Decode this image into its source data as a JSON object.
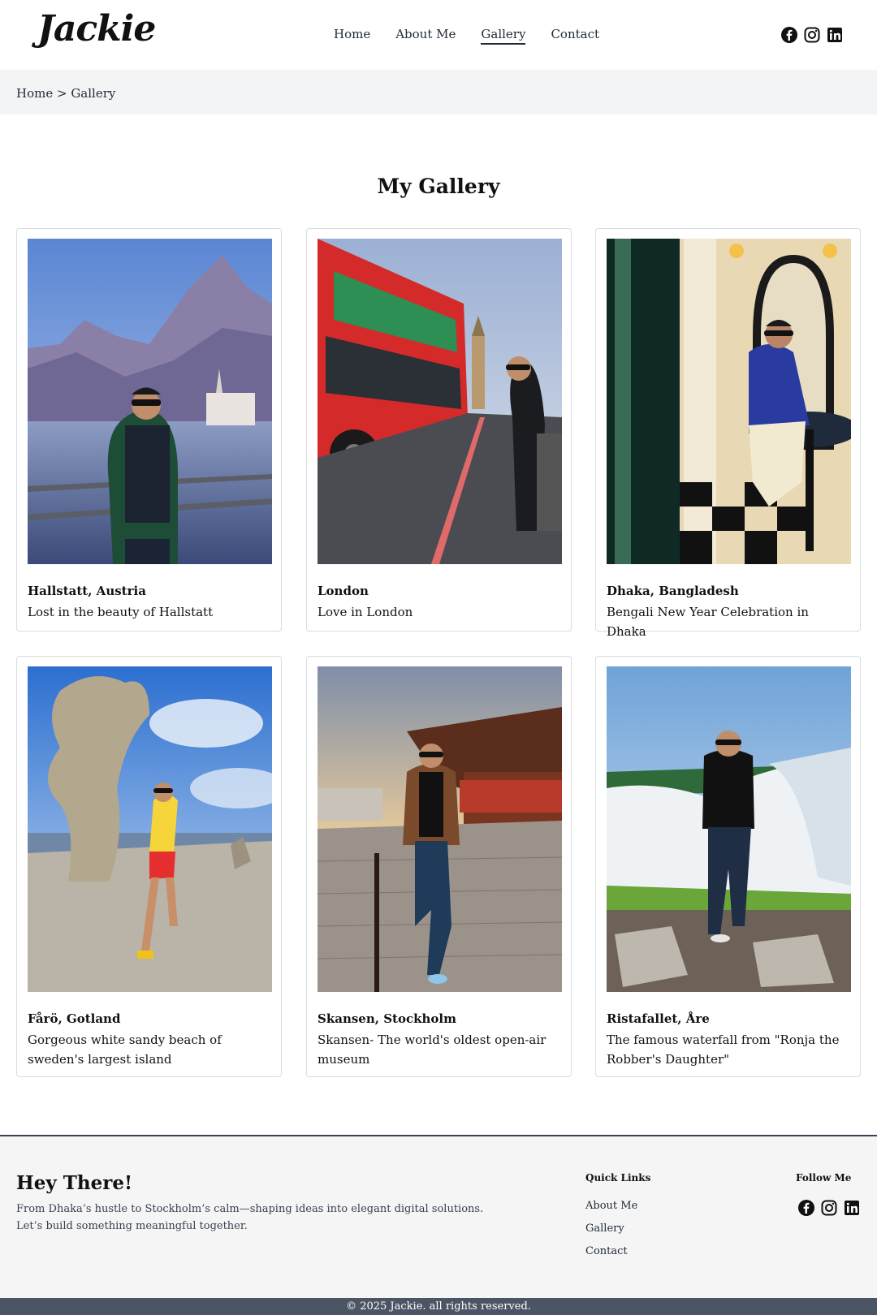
{
  "header": {
    "logo": "Jackie",
    "nav": [
      {
        "label": "Home",
        "active": false
      },
      {
        "label": "About Me",
        "active": false
      },
      {
        "label": "Gallery",
        "active": true
      },
      {
        "label": "Contact",
        "active": false
      }
    ],
    "social_icons": [
      "facebook-icon",
      "instagram-icon",
      "linkedin-icon"
    ]
  },
  "breadcrumb": "Home > Gallery",
  "page_title": "My Gallery",
  "gallery": [
    {
      "title": "Hallstatt, Austria",
      "desc": "Lost in the beauty of Hallstatt"
    },
    {
      "title": "London",
      "desc": "Love in London"
    },
    {
      "title": "Dhaka, Bangladesh",
      "desc": "Bengali New Year Celebration in Dhaka"
    },
    {
      "title": "Fårö, Gotland",
      "desc": "Gorgeous white sandy beach of sweden's largest island"
    },
    {
      "title": "Skansen, Stockholm",
      "desc": "Skansen- The world's oldest open-air museum"
    },
    {
      "title": "Ristafallet, Åre",
      "desc": "The famous waterfall from \"Ronja the Robber's Daughter\""
    }
  ],
  "footer": {
    "heading": "Hey There!",
    "tagline_line1": "From Dhaka’s hustle to Stockholm’s calm—shaping ideas into elegant digital solutions.",
    "tagline_line2": "Let’s build something meaningful together.",
    "quick_links_title": "Quick Links",
    "quick_links": [
      "About Me",
      "Gallery",
      "Contact"
    ],
    "follow_title": "Follow Me"
  },
  "copyright": "© 2025 Jackie. all rights reserved.",
  "colors": {
    "text": "#111827",
    "breadcrumb_bg": "#f3f4f6",
    "footer_bg": "#f5f5f5",
    "copyright_bg": "#4b5563"
  }
}
